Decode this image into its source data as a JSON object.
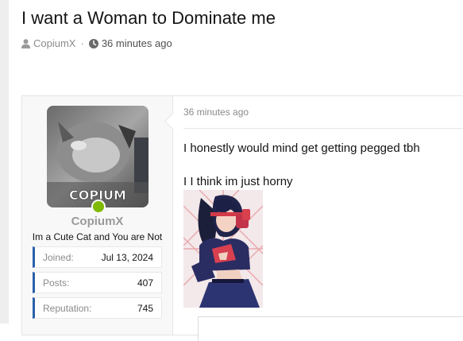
{
  "thread": {
    "title": "I want a Woman to Dominate me",
    "author": "CopiumX",
    "separator": "·",
    "posted": "36 minutes ago"
  },
  "user": {
    "name": "CopiumX",
    "avatar_text": "COPIUM",
    "title": "Im a Cute Cat and You are Not",
    "stats": [
      {
        "label": "Joined:",
        "value": "Jul 13, 2024"
      },
      {
        "label": "Posts:",
        "value": "407"
      },
      {
        "label": "Reputation:",
        "value": "745"
      }
    ]
  },
  "post": {
    "time": "36 minutes ago",
    "lines": [
      "I honestly would mind get getting pegged tbh",
      "I I think im just horny"
    ]
  },
  "colors": {
    "online": "#7fb900",
    "stat_accent": "#2a5fa8"
  },
  "icons": [
    "user-icon",
    "clock-icon"
  ]
}
